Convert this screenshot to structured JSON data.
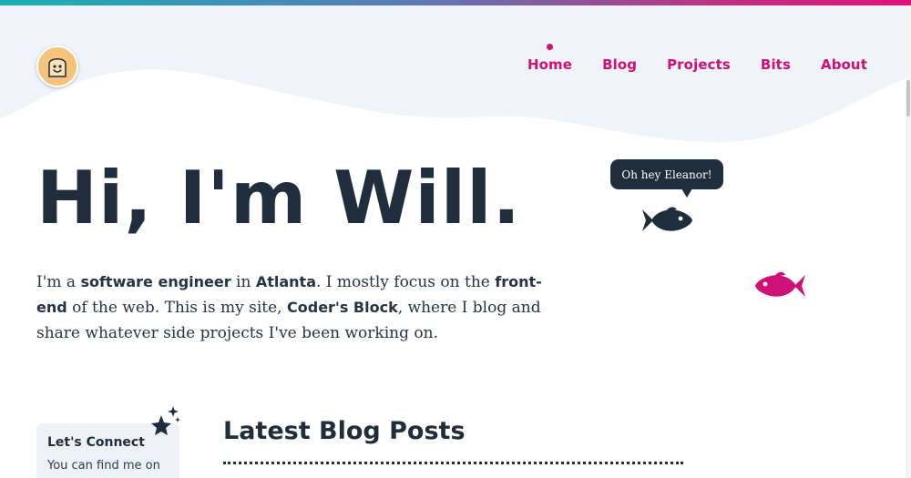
{
  "header": {
    "nav": [
      {
        "label": "Home",
        "active": true
      },
      {
        "label": "Blog"
      },
      {
        "label": "Projects"
      },
      {
        "label": "Bits"
      },
      {
        "label": "About"
      }
    ]
  },
  "hero": {
    "title": "Hi, I'm Will.",
    "intro": {
      "t1": "I'm a ",
      "b1": "software engineer",
      "t2": " in ",
      "b2": "Atlanta",
      "t3": ". I mostly focus on the ",
      "b3": "front-end",
      "t4": " of the web. This is my site, ",
      "b4": "Coder's Block",
      "t5": ", where I blog and share whatever side projects I've been working on."
    },
    "speech_bubble": "Oh hey Eleanor!"
  },
  "sidebar": {
    "connect_title": "Let's Connect",
    "connect_text": "You can find me on"
  },
  "main": {
    "posts_heading": "Latest Blog Posts"
  },
  "colors": {
    "accent": "#cf1076",
    "text_dark": "#1f2d3d",
    "header_bg": "#f0f3f7"
  },
  "icons": {
    "logo": "toast-face-icon",
    "fish_dark": "fish-icon",
    "fish_pink": "fish-icon",
    "sparkle": "sparkle-stars-icon"
  }
}
